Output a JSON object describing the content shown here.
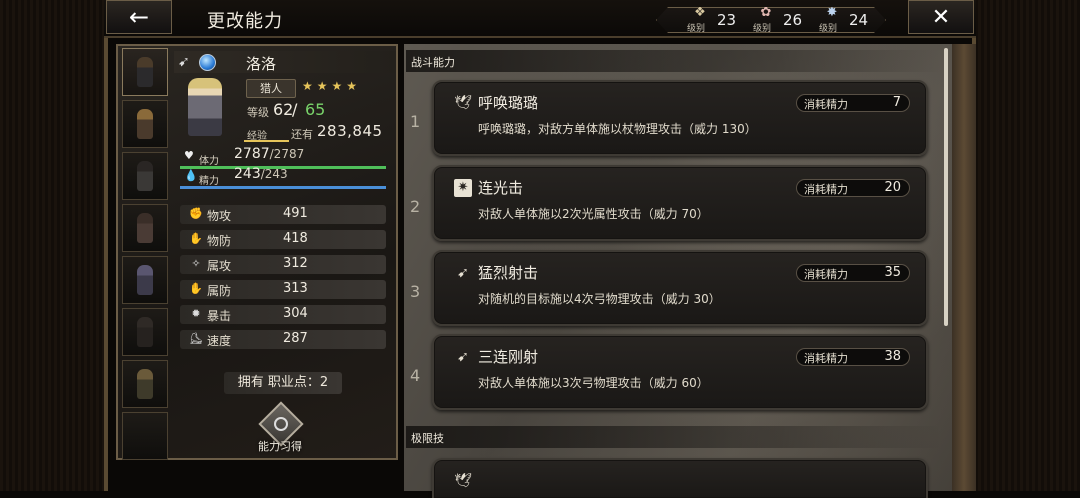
{
  "header": {
    "title": "更改能力",
    "back_glyph": "←",
    "close_glyph": "✕",
    "levels": [
      {
        "icon": "crest-icon",
        "sub": "级别",
        "value": "23"
      },
      {
        "icon": "flower-icon",
        "sub": "级别",
        "value": "26"
      },
      {
        "icon": "star-icon",
        "sub": "级别",
        "value": "24"
      }
    ]
  },
  "character": {
    "name": "洛洛",
    "job": "猎人",
    "stars": "★★★★",
    "level_label": "等级",
    "level": "62",
    "level_sep": "/",
    "level_max": "65",
    "exp_label": "经验",
    "exp_rest_label": "还有",
    "exp_remaining": "283,845",
    "exp_progress": 0.45,
    "hp": {
      "label": "体力",
      "current": "2787",
      "max": "/2787",
      "fraction": 1.0,
      "color": "#4fbf5a"
    },
    "sp": {
      "label": "精力",
      "current": "243",
      "max": "/243",
      "fraction": 1.0,
      "color": "#4a8fd8"
    },
    "stats": [
      {
        "label": "物攻",
        "value": "491",
        "icon": "fist-icon"
      },
      {
        "label": "物防",
        "value": "418",
        "icon": "shield-fist-icon"
      },
      {
        "label": "属攻",
        "value": "312",
        "icon": "sparkle-hand-icon"
      },
      {
        "label": "属防",
        "value": "313",
        "icon": "elemental-guard-icon"
      },
      {
        "label": "暴击",
        "value": "304",
        "icon": "burst-icon"
      },
      {
        "label": "速度",
        "value": "287",
        "icon": "boot-icon"
      }
    ],
    "job_points": "拥有 职业点：2",
    "ability_button": "能力习得"
  },
  "roster": [
    "hunter-portrait",
    "dancer-portrait",
    "warrior-portrait",
    "scholar-portrait",
    "cleric-portrait",
    "thief-portrait",
    "merchant-portrait"
  ],
  "sections": {
    "battle": "战斗能力",
    "limit": "极限技"
  },
  "skills": [
    {
      "index": "1",
      "name": "呼唤璐璐",
      "desc": "呼唤璐璐，对敌方单体施以杖物理攻击（威力 130）",
      "cost_label": "消耗精力",
      "cost": "7",
      "icon": "wing-icon"
    },
    {
      "index": "2",
      "name": "连光击",
      "desc": "对敌人单体施以2次光属性攻击（威力 70）",
      "cost_label": "消耗精力",
      "cost": "20",
      "icon": "light-icon"
    },
    {
      "index": "3",
      "name": "猛烈射击",
      "desc": "对随机的目标施以4次弓物理攻击（威力 30）",
      "cost_label": "消耗精力",
      "cost": "35",
      "icon": "bow-icon"
    },
    {
      "index": "4",
      "name": "三连刚射",
      "desc": "对敌人单体施以3次弓物理攻击（威力 60）",
      "cost_label": "消耗精力",
      "cost": "38",
      "icon": "bow-icon"
    }
  ],
  "colors": {
    "accent_gold": "#e6c45a",
    "level_max_green": "#79d36a"
  }
}
